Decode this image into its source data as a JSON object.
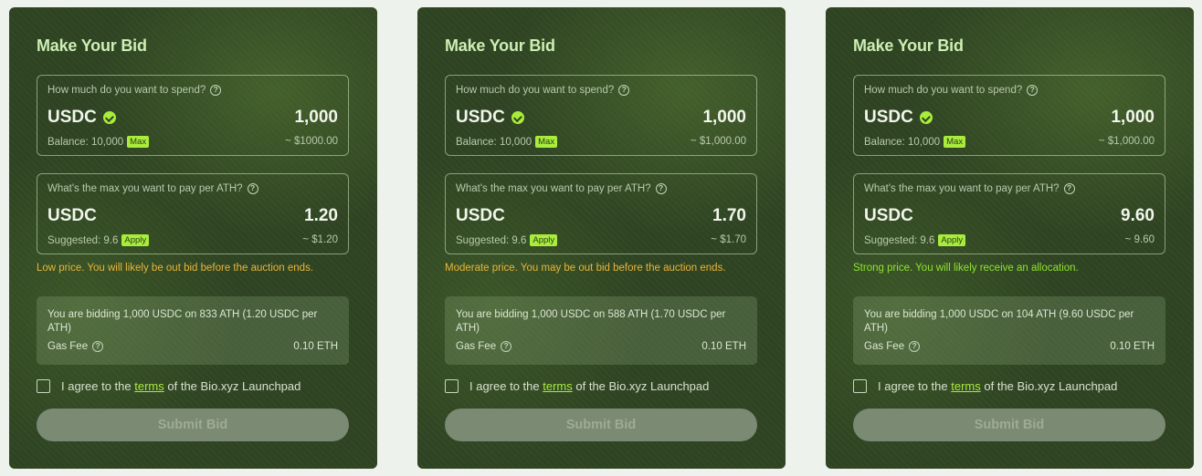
{
  "colors": {
    "card_bg": "#2e4322",
    "accent": "#a9ec3b",
    "hint_low": "#e8b53a",
    "hint_moderate": "#e8b53a",
    "hint_strong": "#8fe330",
    "button_disabled": "#7b8a73"
  },
  "cards": [
    {
      "title": "Make Your Bid",
      "spend": {
        "question": "How much do you want to spend?",
        "currency": "USDC",
        "amount": "1,000",
        "balance": "Balance: 10,000",
        "max_label": "Max",
        "usd": "~ $1000.00"
      },
      "price": {
        "question": "What's the max you want to pay per ATH?",
        "currency": "USDC",
        "amount": "1.20",
        "suggested": "Suggested: 9.6",
        "apply_label": "Apply",
        "usd": "~ $1.20"
      },
      "hint": "Low price. You will likely be out bid before the auction ends.",
      "hint_level": "low",
      "summary": "You are bidding 1,000 USDC on 833 ATH (1.20 USDC per ATH)",
      "gas_label": "Gas Fee",
      "gas_value": "0.10 ETH",
      "agree_prefix": "I agree to the",
      "agree_link": "terms",
      "agree_suffix": "of the Bio.xyz Launchpad",
      "submit_label": "Submit Bid"
    },
    {
      "title": "Make Your Bid",
      "spend": {
        "question": "How much do you want to spend?",
        "currency": "USDC",
        "amount": "1,000",
        "balance": "Balance: 10,000",
        "max_label": "Max",
        "usd": "~ $1,000.00"
      },
      "price": {
        "question": "What's the max you want to pay per ATH?",
        "currency": "USDC",
        "amount": "1.70",
        "suggested": "Suggested: 9.6",
        "apply_label": "Apply",
        "usd": "~ $1.70"
      },
      "hint": "Moderate price. You may be out bid before the auction ends.",
      "hint_level": "moderate",
      "summary": "You are bidding 1,000 USDC on 588 ATH (1.70 USDC per ATH)",
      "gas_label": "Gas Fee",
      "gas_value": "0.10 ETH",
      "agree_prefix": "I agree to the",
      "agree_link": "terms",
      "agree_suffix": "of the Bio.xyz Launchpad",
      "submit_label": "Submit Bid"
    },
    {
      "title": "Make Your Bid",
      "spend": {
        "question": "How much do you want to spend?",
        "currency": "USDC",
        "amount": "1,000",
        "balance": "Balance: 10,000",
        "max_label": "Max",
        "usd": "~ $1,000.00"
      },
      "price": {
        "question": "What's the max you want to pay per ATH?",
        "currency": "USDC",
        "amount": "9.60",
        "suggested": "Suggested: 9.6",
        "apply_label": "Apply",
        "usd": "~ 9.60"
      },
      "hint": "Strong price. You will likely receive an allocation.",
      "hint_level": "strong",
      "summary": "You are bidding 1,000 USDC on 104 ATH (9.60 USDC per ATH)",
      "gas_label": "Gas Fee",
      "gas_value": "0.10 ETH",
      "agree_prefix": "I agree to the",
      "agree_link": "terms",
      "agree_suffix": "of the Bio.xyz Launchpad",
      "submit_label": "Submit Bid"
    }
  ]
}
